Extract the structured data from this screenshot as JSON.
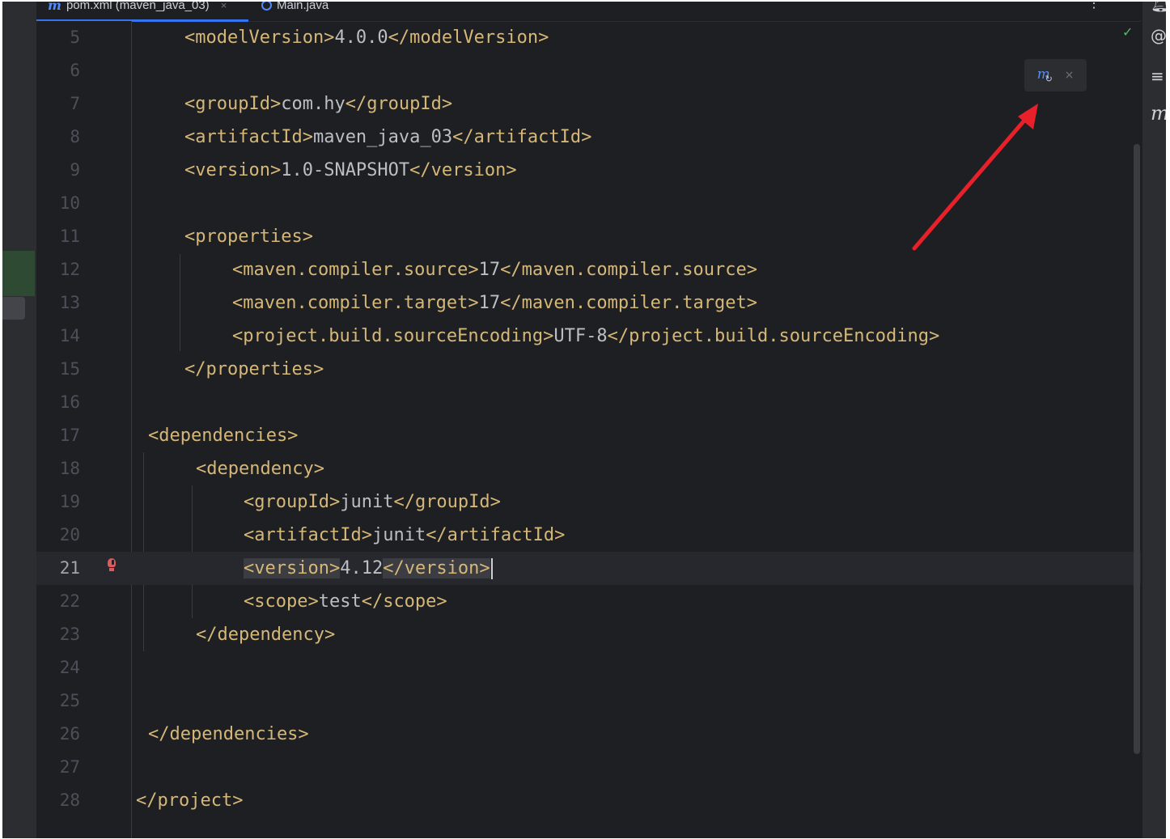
{
  "tabs": [
    {
      "label": "pom.xml (maven_java_03)",
      "icon": "maven-file-icon",
      "close": "×",
      "active": true
    },
    {
      "label": "Main.java",
      "icon": "java-class-icon",
      "active": false
    }
  ],
  "tab_more": "⋮",
  "editor": {
    "current_line": 21,
    "inspection_status": "✓",
    "lines": [
      {
        "n": "5"
      },
      {
        "n": "6"
      },
      {
        "n": "7"
      },
      {
        "n": "8"
      },
      {
        "n": "9"
      },
      {
        "n": "10"
      },
      {
        "n": "11"
      },
      {
        "n": "12"
      },
      {
        "n": "13"
      },
      {
        "n": "14"
      },
      {
        "n": "15"
      },
      {
        "n": "16"
      },
      {
        "n": "17"
      },
      {
        "n": "18"
      },
      {
        "n": "19"
      },
      {
        "n": "20"
      },
      {
        "n": "21"
      },
      {
        "n": "22"
      },
      {
        "n": "23"
      },
      {
        "n": "24"
      },
      {
        "n": "25"
      },
      {
        "n": "26"
      },
      {
        "n": "27"
      },
      {
        "n": "28"
      }
    ],
    "code": {
      "l5": {
        "open": "<modelVersion>",
        "text": "4.0.0",
        "close": "</modelVersion>"
      },
      "l7": {
        "open": "<groupId>",
        "text": "com.hy",
        "close": "</groupId>"
      },
      "l8": {
        "open": "<artifactId>",
        "text": "maven_java_03",
        "close": "</artifactId>"
      },
      "l9": {
        "open": "<version>",
        "text": "1.0-SNAPSHOT",
        "close": "</version>"
      },
      "l11": {
        "open": "<properties>"
      },
      "l12": {
        "open": "<maven.compiler.source>",
        "text": "17",
        "close": "</maven.compiler.source>"
      },
      "l13": {
        "open": "<maven.compiler.target>",
        "text": "17",
        "close": "</maven.compiler.target>"
      },
      "l14": {
        "open": "<project.build.sourceEncoding>",
        "text": "UTF-8",
        "close": "</project.build.sourceEncoding>"
      },
      "l15": {
        "open": "</properties>"
      },
      "l17": {
        "open": "<dependencies>"
      },
      "l18": {
        "open": "<dependency>"
      },
      "l19": {
        "open": "<groupId>",
        "text": "junit",
        "close": "</groupId>"
      },
      "l20": {
        "open": "<artifactId>",
        "text": "junit",
        "close": "</artifactId>"
      },
      "l21": {
        "open": "<version>",
        "text": "4.12",
        "close": "</version>"
      },
      "l22": {
        "open": "<scope>",
        "text": "test",
        "close": "</scope>"
      },
      "l23": {
        "open": "</dependency>"
      },
      "l26": {
        "open": "</dependencies>"
      },
      "l28": {
        "open": "</project>"
      }
    }
  },
  "maven_popup": {
    "icon": "maven-reload-icon",
    "close": "×"
  },
  "right_toolbar": [
    "notifications-icon",
    "ai-assistant-icon",
    "database-icon",
    "maven-icon"
  ],
  "colors": {
    "background": "#1e1f22",
    "tag": "#d5b778",
    "text": "#bcbec4",
    "line_number": "#4b5059",
    "accent": "#3574f0",
    "annotation_arrow": "#e8202a",
    "error_bulb": "#db5c5c",
    "ok_check": "#5fb865"
  }
}
